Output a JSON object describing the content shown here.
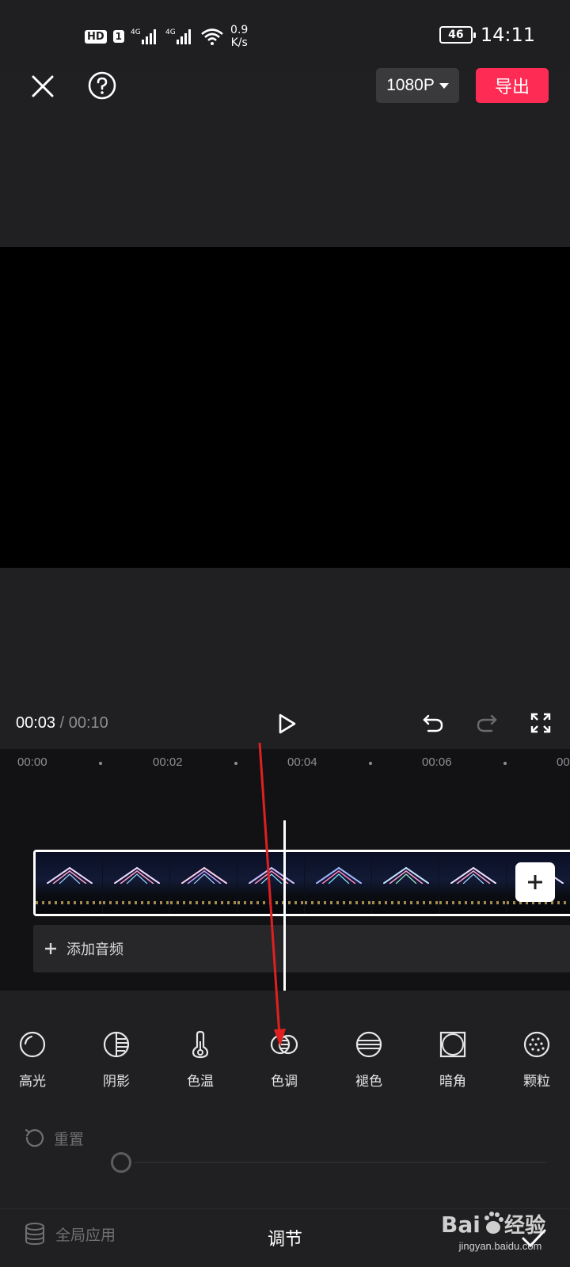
{
  "status_bar": {
    "hd": "HD",
    "sim": "1",
    "net1": "4G",
    "net2": "4G",
    "speed_value": "0.9",
    "speed_unit": "K/s",
    "battery": "46",
    "time": "14:11"
  },
  "top_bar": {
    "resolution": "1080P",
    "export_label": "导出"
  },
  "playback": {
    "current_time": "00:03",
    "separator": " / ",
    "total_time": "00:10"
  },
  "timeline": {
    "ticks": [
      "00:00",
      "00:02",
      "00:04",
      "00:06",
      "00"
    ],
    "add_audio_label": "添加音频"
  },
  "tools": [
    {
      "label": "高光",
      "icon": "highlight-icon"
    },
    {
      "label": "阴影",
      "icon": "shadow-icon"
    },
    {
      "label": "色温",
      "icon": "thermometer-icon"
    },
    {
      "label": "色调",
      "icon": "tone-icon"
    },
    {
      "label": "褪色",
      "icon": "fade-icon"
    },
    {
      "label": "暗角",
      "icon": "vignette-icon"
    },
    {
      "label": "颗粒",
      "icon": "grain-icon"
    }
  ],
  "reset_label": "重置",
  "bottom": {
    "global_apply_label": "全局应用",
    "panel_title": "调节"
  },
  "watermark": {
    "url": "jingyan.baidu.com"
  },
  "colors": {
    "accent": "#fe2c55",
    "background": "#202022",
    "annotation_arrow": "#e02020"
  }
}
